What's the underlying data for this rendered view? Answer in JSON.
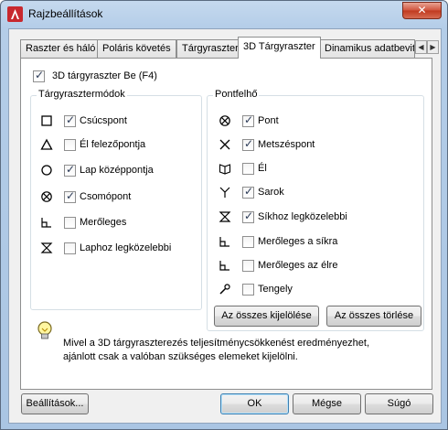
{
  "window": {
    "title": "Rajzbeállítások",
    "close_glyph": "✕"
  },
  "tabs": [
    {
      "label": "Raszter és háló",
      "active": false
    },
    {
      "label": "Poláris követés",
      "active": false
    },
    {
      "label": "Tárgyraszter",
      "active": false
    },
    {
      "label": "3D Tárgyraszter",
      "active": true
    },
    {
      "label": "Dinamikus adatbevit",
      "active": false
    }
  ],
  "tab_scroll": {
    "left": "◀",
    "right": "▶"
  },
  "master": {
    "label": "3D tárgyraszter Be (F4)",
    "checked": true
  },
  "modes_group": {
    "title": "Tárgyrasztermódok",
    "items": [
      {
        "label": "Csúcspont",
        "checked": true,
        "icon": "square-icon"
      },
      {
        "label": "Él felezőpontja",
        "checked": false,
        "icon": "triangle-icon"
      },
      {
        "label": "Lap középpontja",
        "checked": true,
        "icon": "circle-icon"
      },
      {
        "label": "Csomópont",
        "checked": true,
        "icon": "node-icon"
      },
      {
        "label": "Merőleges",
        "checked": false,
        "icon": "perpendicular-icon"
      },
      {
        "label": "Laphoz legközelebbi",
        "checked": false,
        "icon": "nearest-face-icon"
      }
    ]
  },
  "pointcloud_group": {
    "title": "Pontfelhő",
    "items": [
      {
        "label": "Pont",
        "checked": true,
        "icon": "node-icon"
      },
      {
        "label": "Metszéspont",
        "checked": true,
        "icon": "intersection-icon"
      },
      {
        "label": "Él",
        "checked": false,
        "icon": "edge-icon"
      },
      {
        "label": "Sarok",
        "checked": true,
        "icon": "corner-icon"
      },
      {
        "label": "Síkhoz legközelebbi",
        "checked": true,
        "icon": "nearest-plane-icon"
      },
      {
        "label": "Merőleges a síkra",
        "checked": false,
        "icon": "perpendicular-icon"
      },
      {
        "label": "Merőleges az élre",
        "checked": false,
        "icon": "perpendicular-icon"
      },
      {
        "label": "Tengely",
        "checked": false,
        "icon": "axis-icon"
      }
    ]
  },
  "buttons": {
    "select_all": "Az összes kijelölése",
    "clear_all": "Az összes törlése",
    "options": "Beállítások...",
    "ok": "OK",
    "cancel": "Mégse",
    "help": "Súgó"
  },
  "info_text_line1": "Mivel a 3D tárgyraszterezés teljesítménycsökkenést eredményezhet,",
  "info_text_line2": "ajánlott csak a valóban szükséges elemeket kijelölni."
}
